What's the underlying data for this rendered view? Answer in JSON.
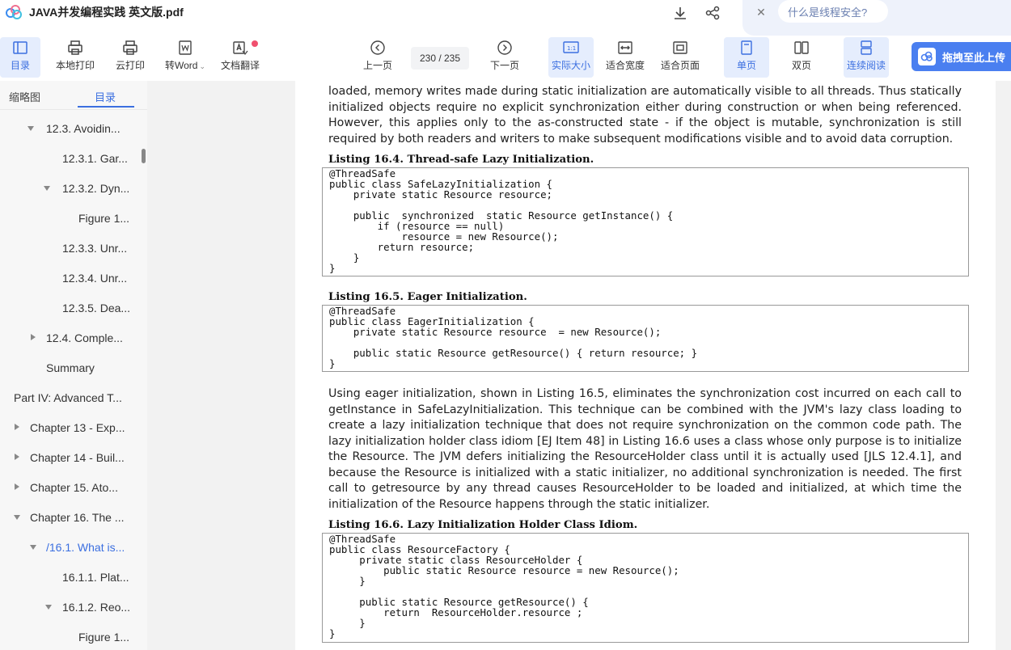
{
  "title_bar": {
    "doc_title": "JAVA并发编程实践 英文版.pdf",
    "ai_question": "什么是线程安全?"
  },
  "toolbar": {
    "toc": "目录",
    "local_print": "本地打印",
    "cloud_print": "云打印",
    "to_word": "转Word",
    "translate": "文档翻译",
    "prev_page": "上一页",
    "page_indicator": "230 / 235",
    "next_page": "下一页",
    "actual_size": "实际大小",
    "fit_width": "适合宽度",
    "fit_page": "适合页面",
    "single_page": "单页",
    "double_page": "双页",
    "continuous": "连续阅读",
    "upload": "拖拽至此上传"
  },
  "sidebar": {
    "tab_thumbnails": "缩略图",
    "tab_toc": "目录",
    "items": [
      {
        "label": "12.3. Avoidin...",
        "caret": "down"
      },
      {
        "label": "12.3.1. Gar...",
        "caret": ""
      },
      {
        "label": "12.3.2. Dyn...",
        "caret": "down"
      },
      {
        "label": "Figure 1...",
        "caret": ""
      },
      {
        "label": "12.3.3. Unr...",
        "caret": ""
      },
      {
        "label": "12.3.4. Unr...",
        "caret": ""
      },
      {
        "label": "12.3.5. Dea...",
        "caret": ""
      },
      {
        "label": "12.4. Comple...",
        "caret": "right"
      },
      {
        "label": "Summary",
        "caret": ""
      },
      {
        "label": "Part IV: Advanced T...",
        "caret": ""
      },
      {
        "label": "Chapter 13 - Exp...",
        "caret": "right"
      },
      {
        "label": "Chapter 14 - Buil...",
        "caret": "right"
      },
      {
        "label": "Chapter 15. Ato...",
        "caret": "right"
      },
      {
        "label": "Chapter 16. The ...",
        "caret": "down"
      },
      {
        "label": "/16.1. What is...",
        "caret": "down"
      },
      {
        "label": "16.1.1. Plat...",
        "caret": ""
      },
      {
        "label": "16.1.2. Reo...",
        "caret": "down"
      },
      {
        "label": "Figure 1...",
        "caret": ""
      }
    ]
  },
  "document": {
    "para1": "loaded, memory writes made during static initialization are automatically visible to all threads. Thus statically initialized objects require no explicit synchronization either during construction or when being referenced. However, this applies only to the as-constructed state - if the object is mutable, synchronization is still required by both readers and writers to make subsequent modifications visible and to avoid data corruption.",
    "listing4_title": "Listing 16.4. Thread-safe Lazy Initialization.",
    "listing4_code": "@ThreadSafe\npublic class SafeLazyInitialization {\n    private static Resource resource;\n\n    public  synchronized  static Resource getInstance() {\n        if (resource == null)\n            resource = new Resource();\n        return resource;\n    }\n}",
    "listing5_title": "Listing 16.5. Eager Initialization.",
    "listing5_code": "@ThreadSafe\npublic class EagerInitialization {\n    private static Resource resource  = new Resource();\n\n    public static Resource getResource() { return resource; }\n}",
    "para2": "Using eager initialization, shown in Listing 16.5, eliminates the synchronization cost incurred on each call to getInstance in SafeLazyInitialization. This technique can be combined with the JVM's lazy class loading to create a lazy initialization technique that does not require synchronization on the common code path. The lazy initialization holder class idiom [EJ Item 48] in Listing 16.6 uses a class whose only purpose is to initialize the Resource. The JVM defers initializing the ResourceHolder class until it is actually used [JLS 12.4.1], and because the Resource is initialized with a static initializer, no additional synchronization is needed. The first call to getresource by any thread causes ResourceHolder to be loaded and initialized, at which time the initialization of the Resource happens through the static initializer.",
    "listing6_title": "Listing 16.6. Lazy Initialization Holder Class Idiom.",
    "listing6_code": "@ThreadSafe\npublic class ResourceFactory {\n     private static class ResourceHolder {\n         public static Resource resource = new Resource();\n     }\n\n     public static Resource getResource() {\n         return  ResourceHolder.resource ;\n     }\n}"
  }
}
